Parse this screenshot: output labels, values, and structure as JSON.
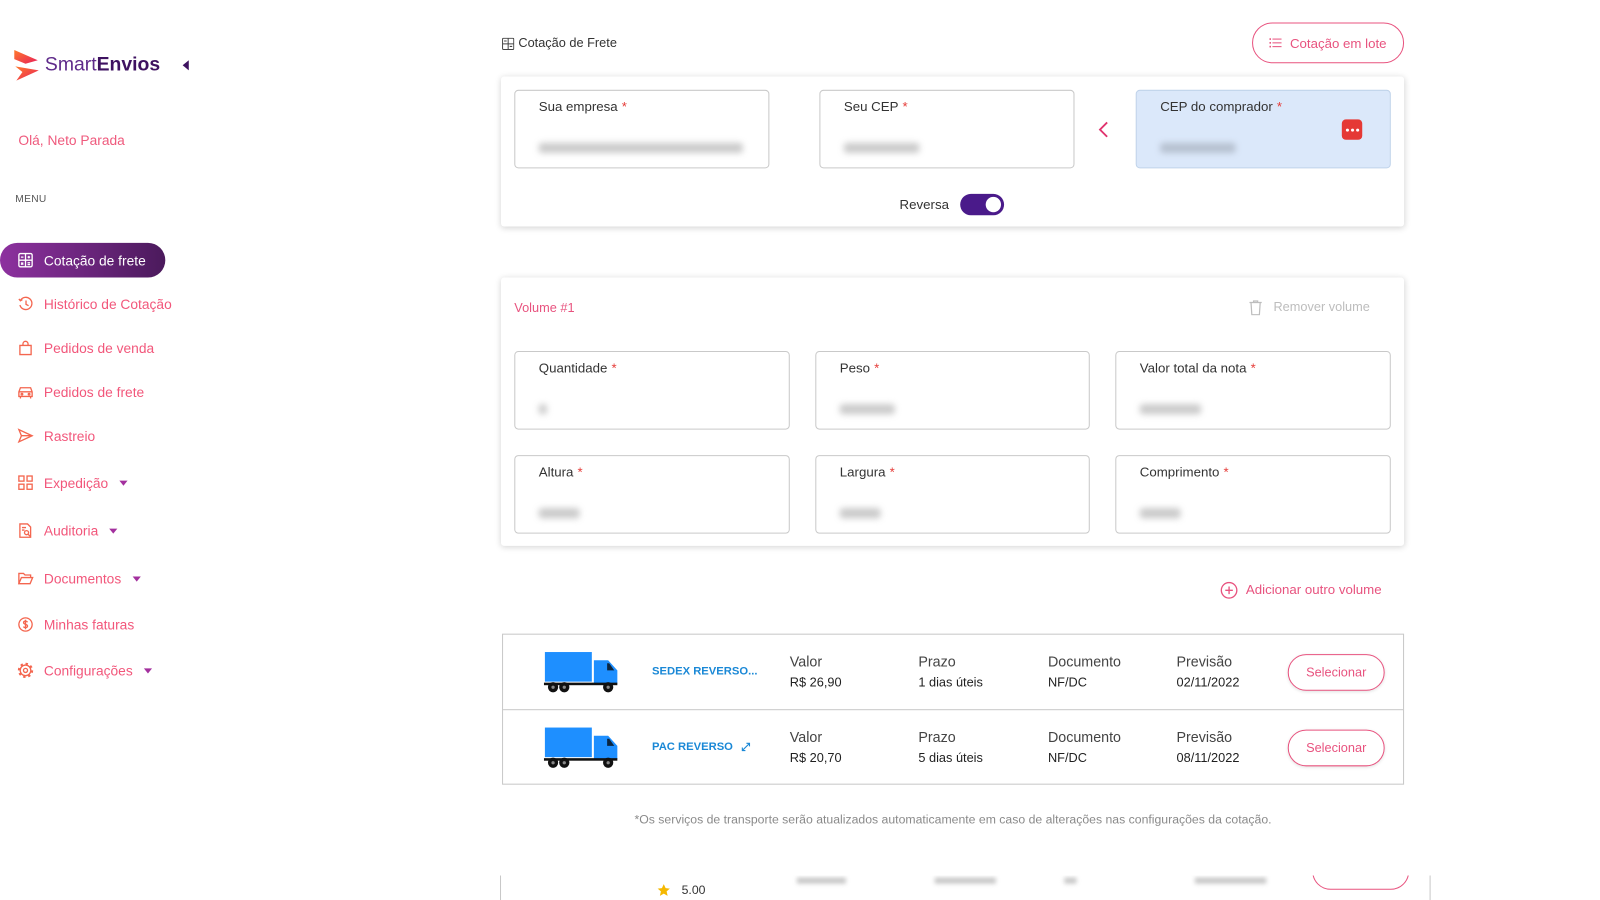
{
  "brand": {
    "name_light": "Smart",
    "name_bold": "Envios",
    "logo_icon": "smartenvios-logo-icon",
    "collapse_icon": "caret-left-icon"
  },
  "user": {
    "greeting": "Olá, Neto Parada"
  },
  "sidebar": {
    "menu_label": "MENU",
    "items": [
      {
        "label": "Cotação de frete",
        "icon": "calculator-icon",
        "active": true,
        "submenu": false
      },
      {
        "label": "Histórico de Cotação",
        "icon": "history-icon",
        "active": false,
        "submenu": false
      },
      {
        "label": "Pedidos de venda",
        "icon": "shopping-bag-icon",
        "active": false,
        "submenu": false
      },
      {
        "label": "Pedidos de frete",
        "icon": "vehicle-icon",
        "active": false,
        "submenu": false
      },
      {
        "label": "Rastreio",
        "icon": "send-icon",
        "active": false,
        "submenu": false
      },
      {
        "label": "Expedição",
        "icon": "grid-icon",
        "active": false,
        "submenu": true
      },
      {
        "label": "Auditoria",
        "icon": "audit-file-icon",
        "active": false,
        "submenu": true
      },
      {
        "label": "Documentos",
        "icon": "folder-icon",
        "active": false,
        "submenu": true
      },
      {
        "label": "Minhas faturas",
        "icon": "dollar-circle-icon",
        "active": false,
        "submenu": false
      },
      {
        "label": "Configurações",
        "icon": "gear-icon",
        "active": false,
        "submenu": true
      }
    ]
  },
  "header": {
    "title": "Cotação de Frete",
    "title_icon": "calculator-icon",
    "batch_button": "Cotação em lote",
    "batch_icon": "list-icon"
  },
  "route_form": {
    "required_mark": "*",
    "company_label": "Sua empresa",
    "origin_cep_label": "Seu CEP",
    "swap_icon": "chevron-left-icon",
    "buyer_cep_label": "CEP do comprador",
    "buyer_cep_icon": "more-dots-icon",
    "reverse_label": "Reversa",
    "reverse_enabled": true
  },
  "volume": {
    "title": "Volume #1",
    "remove_label": "Remover volume",
    "remove_icon": "trash-icon",
    "fields": [
      {
        "label": "Quantidade"
      },
      {
        "label": "Peso"
      },
      {
        "label": "Valor total da nota"
      },
      {
        "label": "Altura"
      },
      {
        "label": "Largura"
      },
      {
        "label": "Comprimento"
      }
    ]
  },
  "add_volume": {
    "label": "Adicionar outro volume",
    "icon": "plus-circle-icon"
  },
  "quotes": {
    "labels": {
      "value": "Valor",
      "deadline": "Prazo",
      "document": "Documento",
      "forecast": "Previsão",
      "select": "Selecionar"
    },
    "rows": [
      {
        "service": "SEDEX REVERSO...",
        "icon": "truck-icon",
        "value": "R$ 26,90",
        "deadline": "1 dias úteis",
        "document": "NF/DC",
        "forecast": "02/11/2022"
      },
      {
        "service": "PAC REVERSO",
        "icon": "truck-icon",
        "expand_icon": "expand-icon",
        "value": "R$ 20,70",
        "deadline": "5 dias úteis",
        "document": "NF/DC",
        "forecast": "08/11/2022"
      }
    ],
    "footnote": "*Os serviços de transporte serão atualizados automaticamente em caso de alterações nas configurações da cotação."
  },
  "partial_row": {
    "rating": "5.00",
    "rating_icon": "star-icon"
  },
  "colors": {
    "accent": "#e8537f",
    "nav_text": "#f2577b",
    "brand_purple": "#4b1a6e",
    "active_from": "#8d319f",
    "active_to": "#4b1a5c",
    "service_blue": "#1a88d6",
    "truck_blue": "#1e8fff",
    "buyer_field_bg": "#dbe8fa",
    "toggle": "#4a1a8a",
    "required": "#e53935"
  }
}
